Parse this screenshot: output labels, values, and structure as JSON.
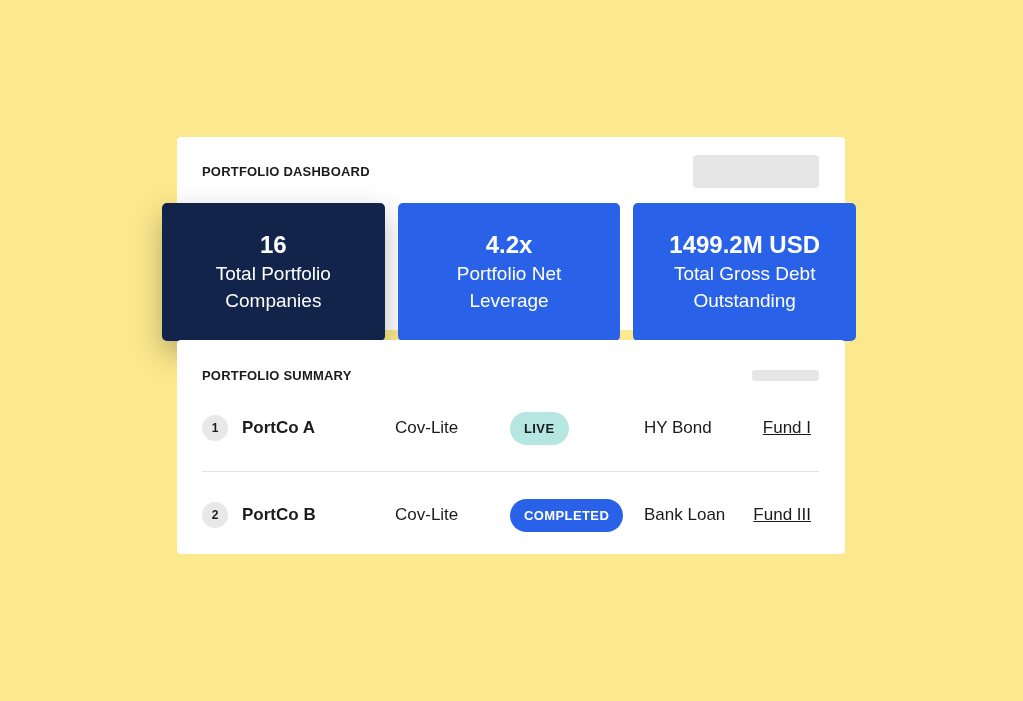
{
  "dashboard": {
    "title": "PORTFOLIO DASHBOARD",
    "stats": [
      {
        "value": "16",
        "label": "Total Portfolio Companies",
        "selected": true
      },
      {
        "value": "4.2x",
        "label": "Portfolio Net Leverage",
        "selected": false
      },
      {
        "value": "1499.2M USD",
        "label": "Total Gross Debt Outstanding",
        "selected": false
      }
    ]
  },
  "summary": {
    "title": "PORTFOLIO SUMMARY",
    "rows": [
      {
        "number": "1",
        "company": "PortCo A",
        "structure": "Cov-Lite",
        "status": {
          "label": "LIVE",
          "kind": "live"
        },
        "instrument": "HY Bond",
        "fund": "Fund I"
      },
      {
        "number": "2",
        "company": "PortCo B",
        "structure": "Cov-Lite",
        "status": {
          "label": "COMPLETED",
          "kind": "completed"
        },
        "instrument": "Bank Loan",
        "fund": "Fund III"
      }
    ]
  }
}
